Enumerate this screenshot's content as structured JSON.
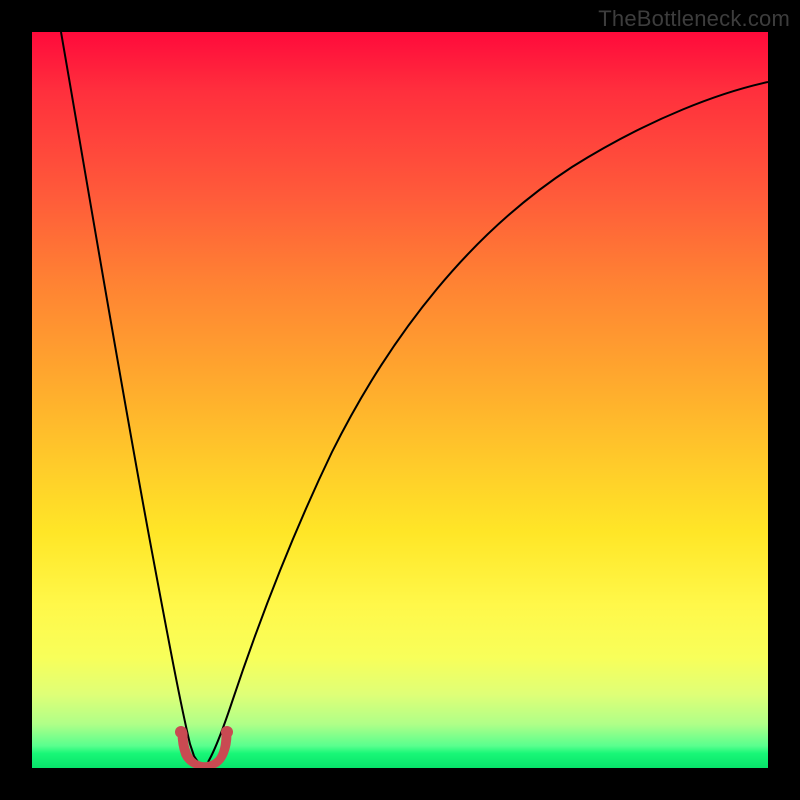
{
  "watermark": "TheBottleneck.com",
  "chart_data": {
    "type": "line",
    "title": "",
    "xlabel": "",
    "ylabel": "",
    "xlim": [
      0,
      100
    ],
    "ylim": [
      0,
      100
    ],
    "grid": false,
    "series": [
      {
        "name": "bottleneck-curve-left",
        "x": [
          4,
          6,
          8,
          10,
          12,
          14,
          16,
          18,
          19,
          20,
          21
        ],
        "y": [
          100,
          84,
          68,
          53,
          39,
          26,
          15,
          6,
          3,
          1,
          0
        ]
      },
      {
        "name": "bottleneck-curve-right",
        "x": [
          23,
          24,
          25,
          27,
          30,
          35,
          40,
          45,
          50,
          55,
          60,
          65,
          70,
          75,
          80,
          85,
          90,
          95,
          100
        ],
        "y": [
          0,
          1,
          3,
          8,
          16,
          28,
          38,
          46,
          53,
          59,
          64,
          68,
          72,
          75,
          78,
          81,
          83,
          85,
          87
        ]
      },
      {
        "name": "bottom-marker",
        "x": [
          19,
          20,
          21,
          22,
          23,
          24,
          25
        ],
        "y": [
          4,
          2,
          1,
          0.5,
          1,
          2,
          4
        ]
      }
    ],
    "colors": {
      "curve": "#000000",
      "marker": "#c94a52",
      "gradient_top": "#ff0a3b",
      "gradient_bottom": "#07e36a"
    }
  }
}
